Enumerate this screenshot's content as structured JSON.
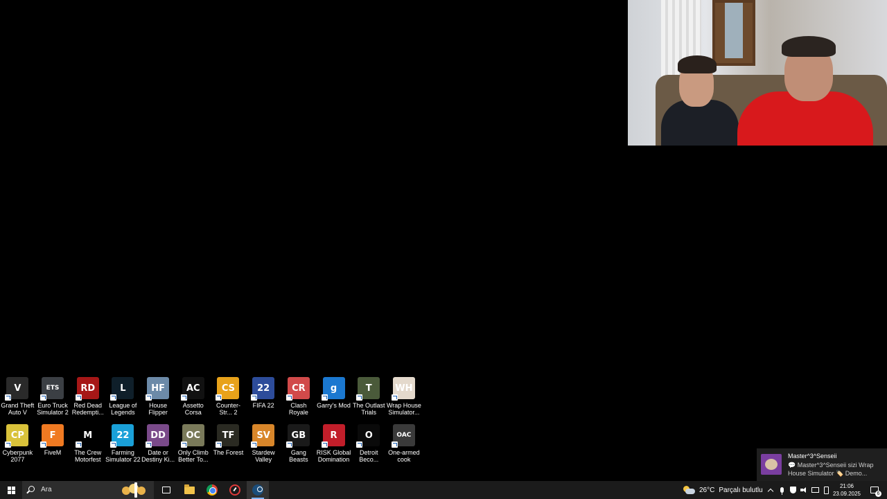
{
  "desktop": {
    "icons_row1": [
      {
        "label": "Grand Theft Auto V",
        "icon": "gta-icon",
        "color": "#2a2a2a",
        "glyph": "V"
      },
      {
        "label": "Euro Truck Simulator 2",
        "icon": "truck-icon",
        "color": "#3b3f44",
        "glyph": "ETS"
      },
      {
        "label": "Red Dead Redempti...",
        "icon": "rdr-icon",
        "color": "#a61717",
        "glyph": "RD"
      },
      {
        "label": "League of Legends",
        "icon": "lol-icon",
        "color": "#0f1f2a",
        "glyph": "L"
      },
      {
        "label": "House Flipper",
        "icon": "house-flipper-icon",
        "color": "#6c8aa8",
        "glyph": "HF"
      },
      {
        "label": "Assetto Corsa",
        "icon": "assetto-icon",
        "color": "#111111",
        "glyph": "AC"
      },
      {
        "label": "Counter-Str... 2",
        "icon": "cs2-icon",
        "color": "#e8a21a",
        "glyph": "CS"
      },
      {
        "label": "FIFA 22",
        "icon": "fifa-icon",
        "color": "#2d4c9a",
        "glyph": "22"
      },
      {
        "label": "Clash Royale",
        "icon": "clash-royale-icon",
        "color": "#d14a4a",
        "glyph": "CR"
      },
      {
        "label": "Garry's Mod",
        "icon": "gmod-icon",
        "color": "#1b78d0",
        "glyph": "g"
      },
      {
        "label": "The Outlast Trials",
        "icon": "outlast-icon",
        "color": "#4a5a3a",
        "glyph": "T"
      },
      {
        "label": "Wrap House Simulator...",
        "icon": "wrap-house-icon",
        "color": "#e4d9cc",
        "glyph": "WH"
      }
    ],
    "icons_row2": [
      {
        "label": "Cyberpunk 2077",
        "icon": "cyberpunk-icon",
        "color": "#d9c23a",
        "glyph": "CP"
      },
      {
        "label": "FiveM",
        "icon": "fivem-icon",
        "color": "#f07a22",
        "glyph": "F"
      },
      {
        "label": "The Crew Motorfest",
        "icon": "crew-icon",
        "color": "#000000",
        "glyph": "M"
      },
      {
        "label": "Farming Simulator 22",
        "icon": "farming-icon",
        "color": "#1aa0d8",
        "glyph": "22"
      },
      {
        "label": "Date or Destiny Ki...",
        "icon": "date-destiny-icon",
        "color": "#7a4a8a",
        "glyph": "DD"
      },
      {
        "label": "Only Climb Better To...",
        "icon": "only-climb-icon",
        "color": "#7a7a5a",
        "glyph": "OC"
      },
      {
        "label": "The Forest",
        "icon": "forest-icon",
        "color": "#2a2a22",
        "glyph": "TF"
      },
      {
        "label": "Stardew Valley",
        "icon": "stardew-icon",
        "color": "#d8862a",
        "glyph": "SV"
      },
      {
        "label": "Gang Beasts",
        "icon": "gang-beasts-icon",
        "color": "#1a1a1a",
        "glyph": "GB"
      },
      {
        "label": "RISK Global Domination",
        "icon": "risk-icon",
        "color": "#c21e2a",
        "glyph": "R"
      },
      {
        "label": "Detroit Beco...",
        "icon": "detroit-icon",
        "color": "#0a0a0a",
        "glyph": "O"
      },
      {
        "label": "One-armed cook",
        "icon": "one-armed-cook-icon",
        "color": "#3a3a3a",
        "glyph": "OAC"
      }
    ]
  },
  "notification": {
    "title": "Master^3^Senseii",
    "message": "💬 Master^3^Senseii sizi Wrap House Simulator 🏷️ Demo..."
  },
  "taskbar": {
    "search_placeholder": "Ara",
    "weather_temp": "26°C",
    "weather_desc": "Parçalı bulutlu",
    "time": "21:06",
    "date": "23.09.2025",
    "notification_count": "6"
  }
}
